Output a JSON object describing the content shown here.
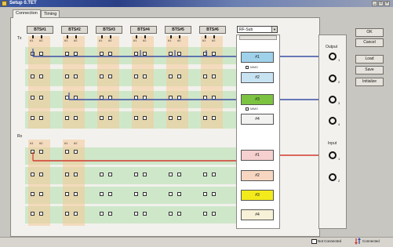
{
  "window": {
    "title": "Setup 0.TET",
    "minimize_glyph": "_",
    "maximize_glyph": "□",
    "close_glyph": "×"
  },
  "tabs": [
    {
      "label": "Connection",
      "active": true
    },
    {
      "label": "Timing",
      "active": false
    }
  ],
  "tx_label": "Tx",
  "rx_label": "Rx",
  "bts_columns": [
    {
      "label": "BTS#1"
    },
    {
      "label": "BTS#2"
    },
    {
      "label": "BTS#3"
    },
    {
      "label": "BTS#4"
    },
    {
      "label": "BTS#5"
    },
    {
      "label": "BTS#6"
    }
  ],
  "port_labels": [
    "#1",
    "#2"
  ],
  "rf_select": {
    "value": "RF-Sub",
    "arrow": "▼"
  },
  "tx_rf_buttons": [
    {
      "label": "#1",
      "color": "#9fd1ea"
    },
    {
      "label": "#2",
      "color": "#c7e3f2"
    },
    {
      "label": "#3",
      "color": "#7cc341"
    },
    {
      "label": "#4",
      "color": "#f2f2f0"
    }
  ],
  "mimo_label": "MIMO",
  "rx_rf_buttons": [
    {
      "label": "#1",
      "color": "#f6cfcf"
    },
    {
      "label": "#2",
      "color": "#f7d6c1"
    },
    {
      "label": "#3",
      "color": "#f3ea1c"
    },
    {
      "label": "#4",
      "color": "#f7f1d8"
    }
  ],
  "output": {
    "label": "Output",
    "ports": [
      "1",
      "2",
      "3",
      "4"
    ]
  },
  "input": {
    "label": "Input",
    "ports": [
      "1",
      "2"
    ]
  },
  "side_buttons": [
    {
      "label": "OK"
    },
    {
      "label": "Cancel"
    },
    {
      "label": "Load"
    },
    {
      "label": "Save"
    },
    {
      "label": "Initialize"
    }
  ],
  "status": {
    "not_connected": "Not Connected",
    "connected": "Connected"
  },
  "colors": {
    "tx_connection": "#3b4fa6",
    "rx_connection": "#d23a2e",
    "band_green": "#cfe7c9",
    "port_strip": "#f6c996"
  }
}
